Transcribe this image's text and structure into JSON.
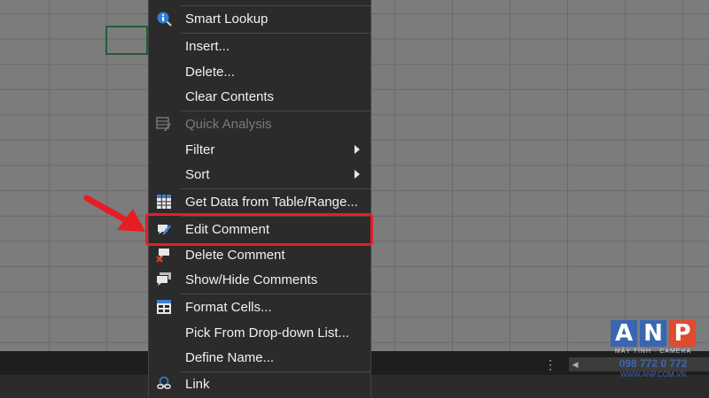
{
  "menu": {
    "items": [
      {
        "label": "Smart Lookup",
        "icon": "smart-lookup-icon",
        "disabled": false
      },
      {
        "label": "Insert...",
        "icon": "",
        "disabled": false
      },
      {
        "label": "Delete...",
        "icon": "",
        "disabled": false
      },
      {
        "label": "Clear Contents",
        "icon": "",
        "disabled": false
      },
      {
        "label": "Quick Analysis",
        "icon": "quick-analysis-icon",
        "disabled": true
      },
      {
        "label": "Filter",
        "icon": "",
        "disabled": false,
        "submenu": true
      },
      {
        "label": "Sort",
        "icon": "",
        "disabled": false,
        "submenu": true
      },
      {
        "label": "Get Data from Table/Range...",
        "icon": "table-icon",
        "disabled": false
      },
      {
        "label": "Edit Comment",
        "icon": "edit-comment-icon",
        "disabled": false
      },
      {
        "label": "Delete Comment",
        "icon": "delete-comment-icon",
        "disabled": false
      },
      {
        "label": "Show/Hide Comments",
        "icon": "show-hide-comments-icon",
        "disabled": false
      },
      {
        "label": "Format Cells...",
        "icon": "format-cells-icon",
        "disabled": false
      },
      {
        "label": "Pick From Drop-down List...",
        "icon": "",
        "disabled": false
      },
      {
        "label": "Define Name...",
        "icon": "",
        "disabled": false
      },
      {
        "label": "Link",
        "icon": "link-icon",
        "disabled": false
      }
    ]
  },
  "status_bar": {
    "more_icon": "⋮",
    "scroll_left_icon": "◀"
  },
  "watermark": {
    "letters": [
      "A",
      "N",
      "P"
    ],
    "tagline": "MÁY TÍNH · CAMERA",
    "phone": "098 772 0 772",
    "site": "WWW.ANP.COM.VN"
  },
  "colors": {
    "highlight": "#e81c24",
    "menu_bg": "#2b2b2b",
    "grid_bg": "#7c7c7c",
    "watermark_blue": "#3a66b0",
    "watermark_red": "#e04a2f"
  }
}
